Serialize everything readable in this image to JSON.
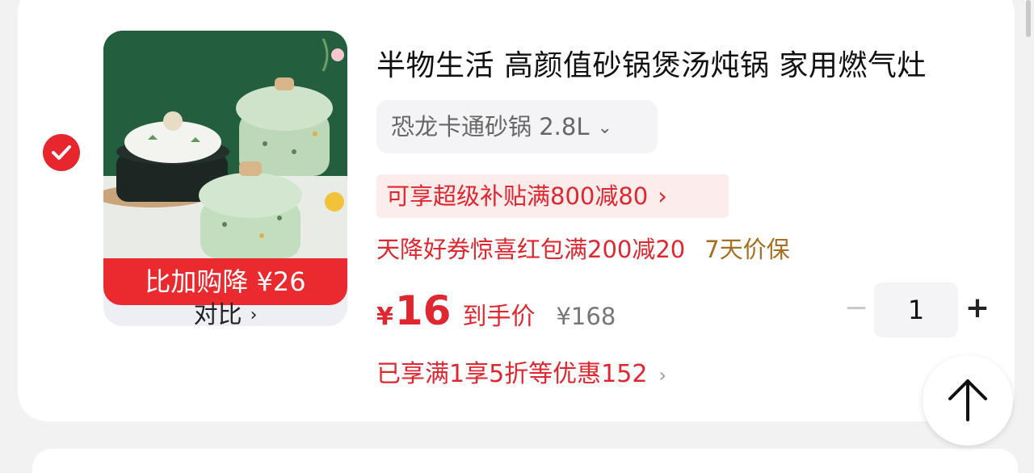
{
  "product": {
    "title": "半物生活 高颜值砂锅煲汤炖锅 家用燃气灶",
    "spec": "恐龙卡通砂锅 2.8L",
    "spec_chevron": "⌄",
    "promo_tag": "可享超级补贴满800减80",
    "coupon_text": "天降好券惊喜红包满200减20",
    "price_protect": "7天价保",
    "currency": "¥",
    "final_price": "16",
    "final_price_label": "到手价",
    "original_price": "¥168",
    "discount_summary": "已享满1享5折等优惠152"
  },
  "thumbnail": {
    "price_drop_label": "比加购降 ¥26",
    "compare_label": "对比"
  },
  "quantity": {
    "minus": "−",
    "value": "1",
    "plus": "+"
  },
  "icons": {
    "checkbox": "check-icon",
    "back_to_top": "arrow-up-icon",
    "chevron": "chevron-right-icon"
  },
  "colors": {
    "accent": "#e0262f",
    "checkbox": "#e8262d",
    "price_drop_bg": "#ea2a2f",
    "promo_bg": "#fdecec",
    "price_protect": "#a76f1e"
  }
}
